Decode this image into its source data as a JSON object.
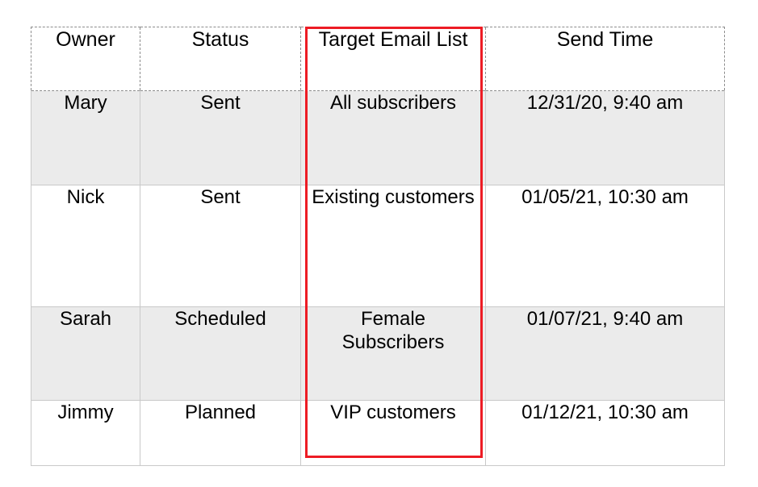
{
  "table": {
    "columns": [
      {
        "key": "owner",
        "label": "Owner"
      },
      {
        "key": "status",
        "label": "Status"
      },
      {
        "key": "target",
        "label": "Target Email List"
      },
      {
        "key": "send",
        "label": "Send Time"
      }
    ],
    "rows": [
      {
        "owner": "Mary",
        "status": "Sent",
        "target": "All subscribers",
        "send": "12/31/20, 9:40 am"
      },
      {
        "owner": "Nick",
        "status": "Sent",
        "target": "Existing customers",
        "send": "01/05/21, 10:30 am"
      },
      {
        "owner": "Sarah",
        "status": "Scheduled",
        "target": "Female Subscribers",
        "send": "01/07/21, 9:40 am"
      },
      {
        "owner": "Jimmy",
        "status": "Planned",
        "target": "VIP customers",
        "send": "01/12/21, 10:30 am"
      }
    ]
  },
  "annotation": {
    "highlight_column": "Target Email List",
    "highlight_color": "#ED1C24"
  },
  "colors": {
    "shaded_row": "#EBEBEB",
    "row_border": "#C9C9C9",
    "header_border": "#8C8C8C",
    "text": "#000000",
    "background": "#FFFFFF"
  }
}
